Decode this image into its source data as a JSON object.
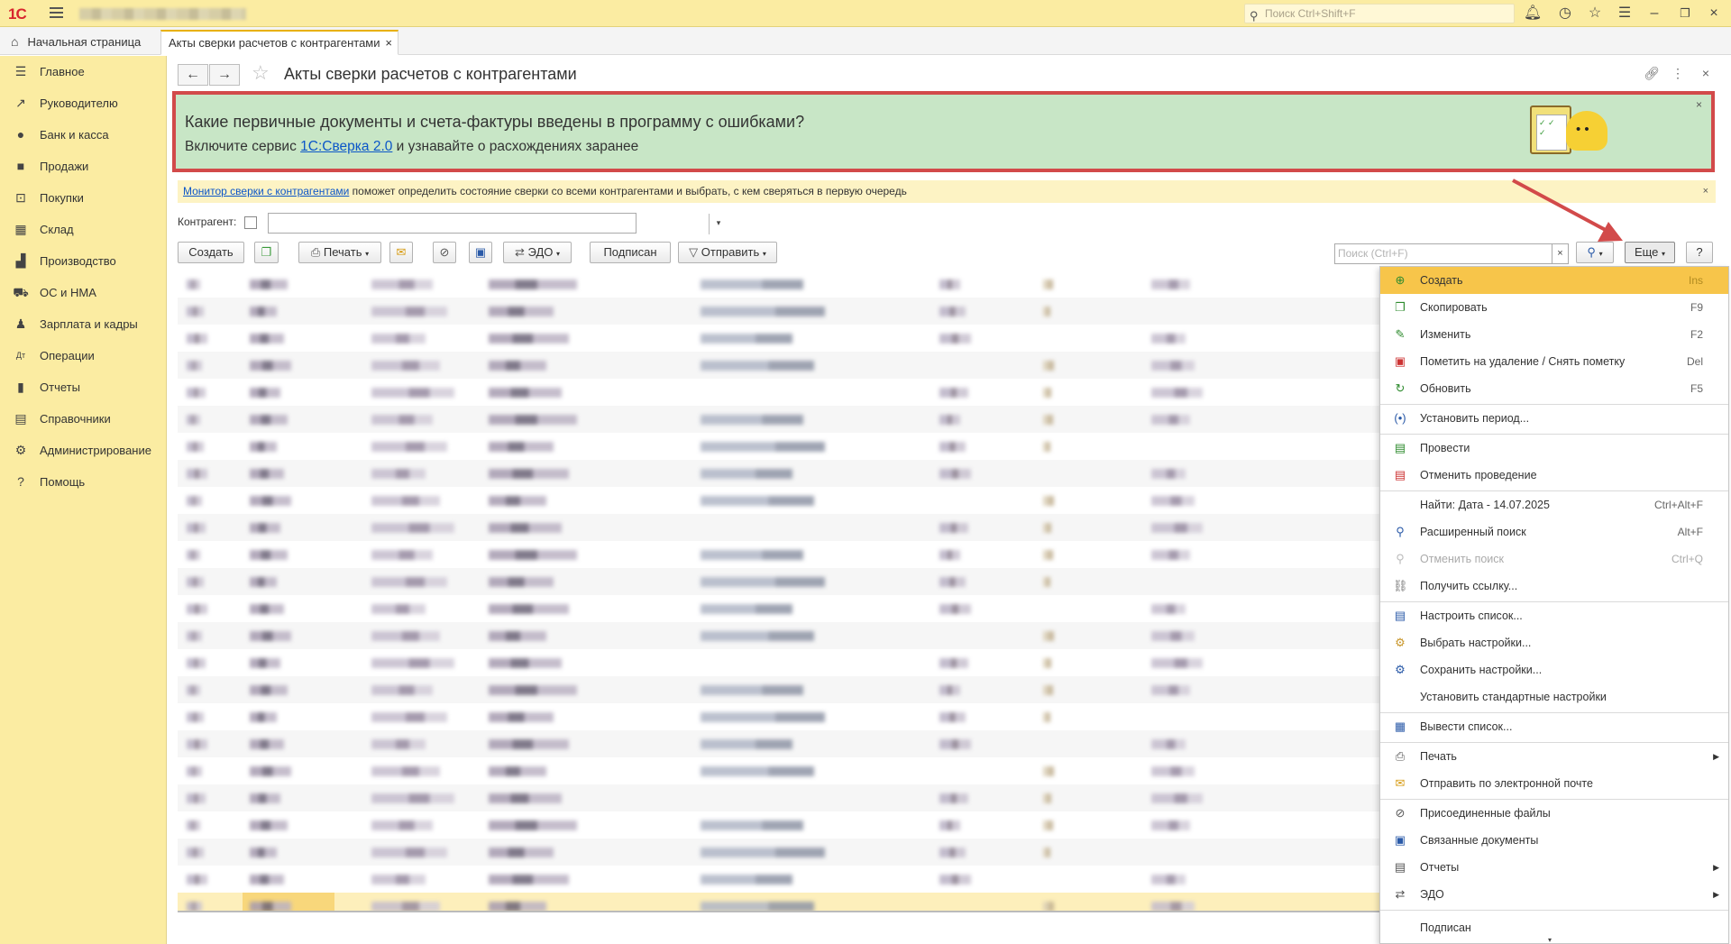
{
  "titlebar": {
    "logo": "1С",
    "search_placeholder": "Поиск Ctrl+Shift+F"
  },
  "tabs": [
    {
      "label": "Начальная страница"
    },
    {
      "label": "Акты сверки расчетов с контрагентами"
    }
  ],
  "sidebar": {
    "items": [
      {
        "label": "Главное"
      },
      {
        "label": "Руководителю"
      },
      {
        "label": "Банк и касса"
      },
      {
        "label": "Продажи"
      },
      {
        "label": "Покупки"
      },
      {
        "label": "Склад"
      },
      {
        "label": "Производство"
      },
      {
        "label": "ОС и НМА"
      },
      {
        "label": "Зарплата и кадры"
      },
      {
        "label": "Операции"
      },
      {
        "label": "Отчеты"
      },
      {
        "label": "Справочники"
      },
      {
        "label": "Администрирование"
      },
      {
        "label": "Помощь"
      }
    ]
  },
  "page": {
    "title": "Акты сверки расчетов с контрагентами"
  },
  "banner": {
    "question": "Какие первичные документы и счета-фактуры введены в программу с ошибками?",
    "line_prefix": "Включите сервис ",
    "link": "1С:Сверка 2.0",
    "line_suffix": " и узнавайте о расхождениях заранее"
  },
  "info": {
    "link": "Монитор сверки с контрагентами",
    "text": " поможет определить состояние сверки со всеми контрагентами и выбрать, с кем сверяться в первую очередь"
  },
  "filter": {
    "label": "Контрагент:"
  },
  "toolbar": {
    "create": "Создать",
    "print": "Печать",
    "edo": "ЭДО",
    "signed": "Подписан",
    "send": "Отправить",
    "search_placeholder": "Поиск (Ctrl+F)",
    "more": "Еще",
    "help": "?"
  },
  "menu": {
    "items": [
      {
        "label": "Создать",
        "shortcut": "Ins"
      },
      {
        "label": "Скопировать",
        "shortcut": "F9"
      },
      {
        "label": "Изменить",
        "shortcut": "F2"
      },
      {
        "label": "Пометить на удаление / Снять пометку",
        "shortcut": "Del"
      },
      {
        "label": "Обновить",
        "shortcut": "F5"
      },
      {
        "label": "Установить период..."
      },
      {
        "label": "Провести"
      },
      {
        "label": "Отменить проведение"
      },
      {
        "label": "Найти: Дата - 14.07.2025",
        "shortcut": "Ctrl+Alt+F"
      },
      {
        "label": "Расширенный поиск",
        "shortcut": "Alt+F"
      },
      {
        "label": "Отменить поиск",
        "shortcut": "Ctrl+Q"
      },
      {
        "label": "Получить ссылку..."
      },
      {
        "label": "Настроить список..."
      },
      {
        "label": "Выбрать настройки..."
      },
      {
        "label": "Сохранить настройки..."
      },
      {
        "label": "Установить стандартные настройки"
      },
      {
        "label": "Вывести список..."
      },
      {
        "label": "Печать"
      },
      {
        "label": "Отправить по электронной почте"
      },
      {
        "label": "Присоединенные файлы"
      },
      {
        "label": "Связанные документы"
      },
      {
        "label": "Отчеты"
      },
      {
        "label": "ЭДО"
      },
      {
        "label": "Подписан"
      }
    ]
  },
  "colors": {
    "accent_yellow": "#fbeca2",
    "highlight": "#f7c54a",
    "banner_green": "#c8e6c6",
    "annotation_red": "#d24a4a",
    "link_blue": "#0b56c8"
  }
}
